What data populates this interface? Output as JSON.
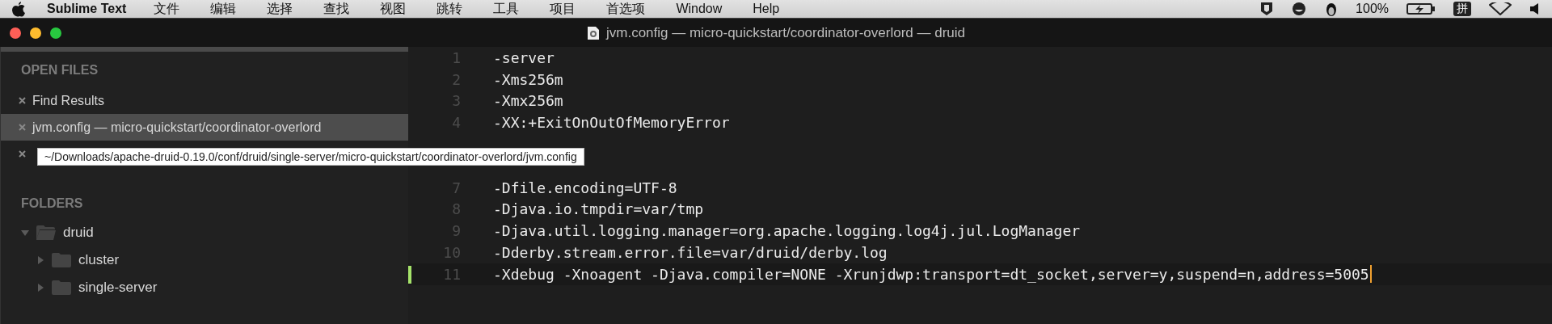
{
  "menu_bar": {
    "app_name": "Sublime Text",
    "items": [
      "文件",
      "编辑",
      "选择",
      "查找",
      "视图",
      "跳转",
      "工具",
      "项目",
      "首选项",
      "Window",
      "Help"
    ],
    "battery_text": "100%",
    "input_method": "拼"
  },
  "window": {
    "title": "jvm.config — micro-quickstart/coordinator-overlord — druid"
  },
  "sidebar": {
    "open_files_heading": "OPEN FILES",
    "open_files": [
      {
        "label": "Find Results",
        "selected": false
      },
      {
        "label": "jvm.config — micro-quickstart/coordinator-overlord",
        "selected": true
      },
      {
        "selected": false
      }
    ],
    "tooltip": "~/Downloads/apache-druid-0.19.0/conf/druid/single-server/micro-quickstart/coordinator-overlord/jvm.config",
    "folders_heading": "FOLDERS",
    "folders": [
      {
        "label": "druid",
        "expanded": true,
        "children": [
          {
            "label": "cluster",
            "expanded": false
          },
          {
            "label": "single-server",
            "expanded": false
          }
        ]
      }
    ]
  },
  "editor": {
    "lines": [
      {
        "number": "1",
        "text": "-server",
        "current": false
      },
      {
        "number": "2",
        "text": "-Xms256m",
        "current": false
      },
      {
        "number": "3",
        "text": "-Xmx256m",
        "current": false
      },
      {
        "number": "4",
        "text": "-XX:+ExitOnOutOfMemoryError",
        "current": false
      },
      {
        "number": "7",
        "text": "-Dfile.encoding=UTF-8",
        "current": false
      },
      {
        "number": "8",
        "text": "-Djava.io.tmpdir=var/tmp",
        "current": false
      },
      {
        "number": "9",
        "text": "-Djava.util.logging.manager=org.apache.logging.log4j.jul.LogManager",
        "current": false
      },
      {
        "number": "10",
        "text": "-Dderby.stream.error.file=var/druid/derby.log",
        "current": false
      },
      {
        "number": "11",
        "text": "-Xdebug -Xnoagent -Djava.compiler=NONE -Xrunjdwp:transport=dt_socket,server=y,suspend=n,address=5005",
        "current": true
      }
    ]
  }
}
